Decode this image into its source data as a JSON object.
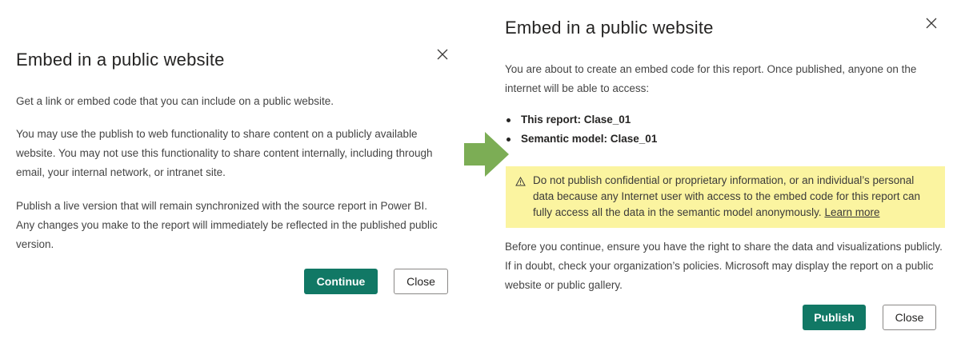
{
  "left": {
    "title": "Embed in a public website",
    "p1": "Get a link or embed code that you can include on a public website.",
    "p2": "You may use the publish to web functionality to share content on a publicly available website. You may not use this functionality to share content internally, including through email, your internal network, or intranet site.",
    "p3": "Publish a live version that will remain synchronized with the source report in Power BI. Any changes you make to the report will immediately be reflected in the published public version.",
    "continue_label": "Continue",
    "close_label": "Close"
  },
  "right": {
    "title": "Embed in a public website",
    "intro": "You are about to create an embed code for this report. Once published, anyone on the internet will be able to access:",
    "bullets": [
      "This report: Clase_01",
      "Semantic model: Clase_01"
    ],
    "warning_text": "Do not publish confidential or proprietary information, or an individual’s personal data because any Internet user with access to the embed code for this report can fully access all the data in the semantic model anonymously.",
    "learn_more": "Learn more",
    "outro": "Before you continue, ensure you have the right to share the data and visualizations publicly. If in doubt, check your organization’s policies. Microsoft may display the report on a public website or public gallery.",
    "publish_label": "Publish",
    "close_label": "Close"
  },
  "colors": {
    "primary_button": "#117865",
    "warning_background": "#fbf4a0",
    "arrow": "#7cad55"
  },
  "icons": [
    "close-icon",
    "warning-icon",
    "arrow-right-icon"
  ]
}
